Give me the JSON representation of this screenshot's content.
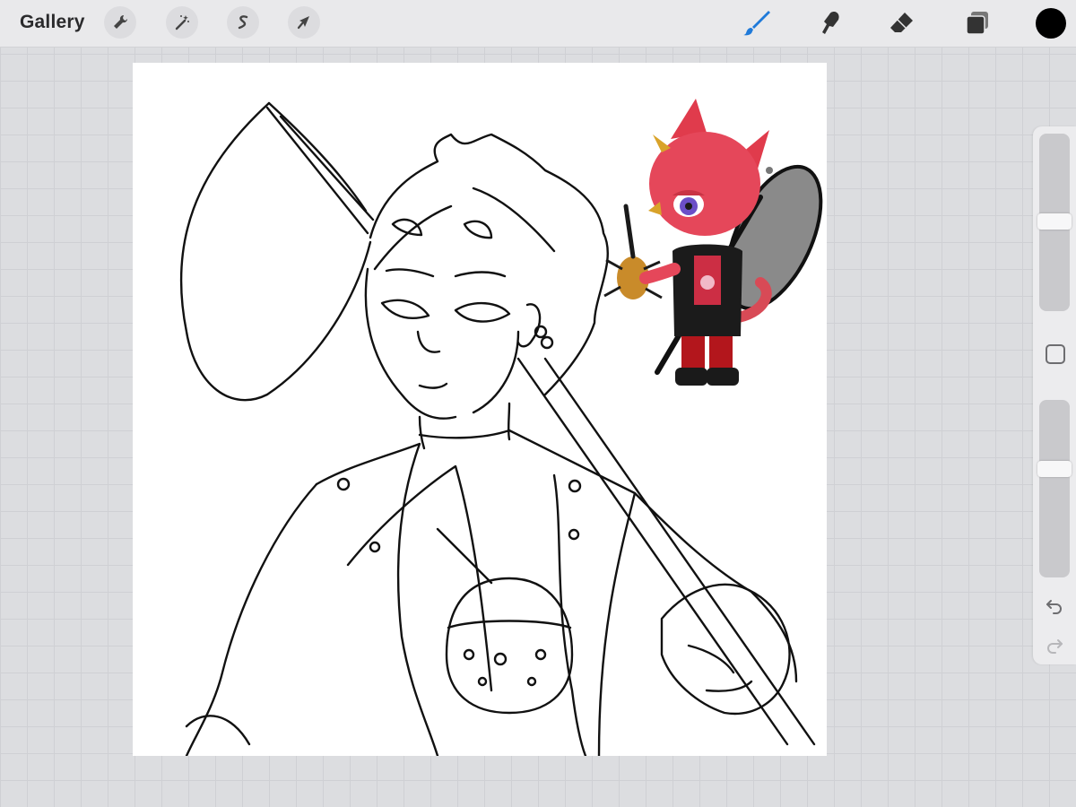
{
  "toolbar": {
    "gallery_label": "Gallery",
    "left_tools": [
      "wrench-icon",
      "magic-wand-icon",
      "selection-icon",
      "transform-arrow-icon"
    ],
    "right_tools": [
      "brush-icon",
      "smudge-icon",
      "eraser-icon",
      "layers-icon"
    ],
    "active_tool": "brush-icon",
    "active_color": "#000000",
    "accent_color": "#1f7ad9"
  },
  "sidebar": {
    "brush_size_level": 0.62,
    "opacity_level": 0.62,
    "undo_icon": "undo-icon",
    "redo_icon": "redo-icon"
  }
}
